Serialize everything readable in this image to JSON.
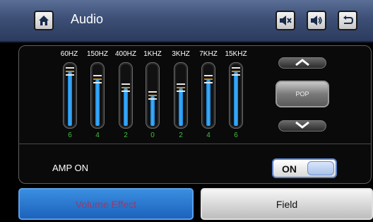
{
  "header": {
    "title": "Audio",
    "home_icon": "home-icon",
    "mute_icon": "speaker-mute-icon",
    "volume_icon": "speaker-volume-icon",
    "back_icon": "back-arrow-icon"
  },
  "eq": {
    "bands": [
      {
        "label": "60HZ",
        "value": "6",
        "level": 6
      },
      {
        "label": "150HZ",
        "value": "4",
        "level": 4
      },
      {
        "label": "400HZ",
        "value": "2",
        "level": 2
      },
      {
        "label": "1KHZ",
        "value": "0",
        "level": 0
      },
      {
        "label": "3KHZ",
        "value": "2",
        "level": 2
      },
      {
        "label": "7KHZ",
        "value": "4",
        "level": 4
      },
      {
        "label": "15KHZ",
        "value": "6",
        "level": 6
      }
    ],
    "range": [
      -7,
      7
    ],
    "preset": "POP"
  },
  "amp": {
    "label": "AMP ON",
    "toggle_text": "ON"
  },
  "tabs": {
    "volume_effect": "Volume Effect",
    "field": "Field"
  },
  "colors": {
    "title_bar": "#3d4f76",
    "slider_fill": "#3fb0ff",
    "value_text": "#40c040",
    "active_tab": "#1c62bc"
  }
}
